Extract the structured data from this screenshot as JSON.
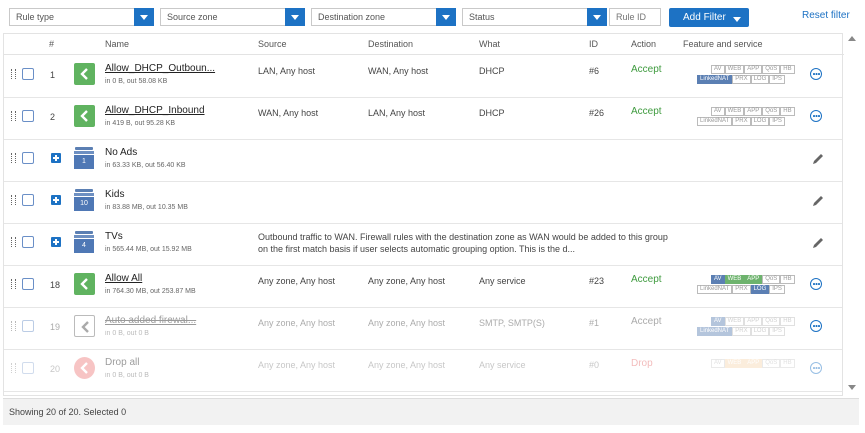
{
  "filters": {
    "rule_type": "Rule type",
    "source_zone": "Source zone",
    "destination_zone": "Destination zone",
    "status": "Status",
    "rule_id_placeholder": "Rule ID",
    "add_filter": "Add Filter",
    "reset_filter": "Reset filter"
  },
  "columns": {
    "num": "#",
    "name": "Name",
    "source": "Source",
    "destination": "Destination",
    "what": "What",
    "id": "ID",
    "action": "Action",
    "feature": "Feature and service"
  },
  "colors": {
    "accent": "#1d72c4",
    "accept": "#3f9b3f",
    "drop": "#e36b6b",
    "rule_icon": "#60b360",
    "group_icon": "#4f78b5"
  },
  "rows": [
    {
      "num": "1",
      "name": "Allow_DHCP_Outboun...",
      "sub": "in 0 B, out 58.08 KB",
      "source": "LAN, Any host",
      "destination": "WAN, Any host",
      "what": "DHCP",
      "id": "#6",
      "action": "Accept"
    },
    {
      "num": "2",
      "name": "Allow_DHCP_Inbound",
      "sub": "in 419 B, out 95.28 KB",
      "source": "WAN, Any host",
      "destination": "LAN, Any host",
      "what": "DHCP",
      "id": "#26",
      "action": "Accept"
    },
    {
      "name": "No Ads",
      "count": "1",
      "sub": "in 63.33 KB, out 56.40 KB"
    },
    {
      "name": "Kids",
      "count": "10",
      "sub": "in 83.88 MB, out 10.35 MB"
    },
    {
      "name": "TVs",
      "count": "4",
      "sub": "in 565.44 MB, out 15.92 MB",
      "desc": "Outbound traffic to WAN. Firewall rules with the destination zone as WAN would be added to this group on the first match basis if user selects automatic grouping option. This is the d..."
    },
    {
      "num": "18",
      "name": "Allow All",
      "sub": "in 764.30 MB, out 253.87 MB",
      "source": "Any zone, Any host",
      "destination": "Any zone, Any host",
      "what": "Any service",
      "id": "#23",
      "action": "Accept"
    },
    {
      "num": "19",
      "name": "Auto added firewal...",
      "sub": "in 0 B, out 0 B",
      "source": "Any zone, Any host",
      "destination": "Any zone, Any host",
      "what": "SMTP, SMTP(S)",
      "id": "#1",
      "action": "Accept"
    },
    {
      "num": "20",
      "name": "Drop all",
      "sub": "in 0 B, out 0 B",
      "source": "Any zone, Any host",
      "destination": "Any zone, Any host",
      "what": "Any service",
      "id": "#0",
      "action": "Drop"
    }
  ],
  "badges": {
    "av": "AV",
    "web": "WEB",
    "app": "APP",
    "qos": "QoS",
    "hb": "HB",
    "linkednat": "LinkedNAT",
    "prx": "PRX",
    "log": "LOG",
    "ips": "IPS"
  },
  "icons": {
    "drag": "drag-handle-icon",
    "rule": "share-icon",
    "group": "group-icon",
    "expand": "plus-icon",
    "more": "more-options-icon",
    "edit": "pencil-icon",
    "drop": "stop-icon"
  },
  "footer": {
    "status": "Showing 20 of 20. Selected 0"
  }
}
